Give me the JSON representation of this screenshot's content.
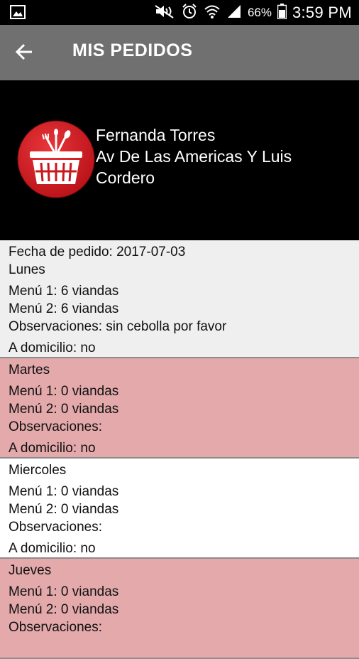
{
  "status_bar": {
    "battery_percent": "66%",
    "time": "3:59 PM"
  },
  "toolbar": {
    "title": "MIS PEDIDOS"
  },
  "profile": {
    "name": "Fernanda Torres",
    "address_line1": "Av De Las Americas Y Luis",
    "address_line2": "Cordero"
  },
  "order": {
    "date_text": "Fecha de pedido: 2017-07-03",
    "days": [
      {
        "day": "Lunes",
        "menu1": "Menú 1: 6 viandas",
        "menu2": "Menú 2: 6 viandas",
        "obs": "Observaciones: sin cebolla por favor",
        "delivery": "A domicilio: no"
      },
      {
        "day": "Martes",
        "menu1": "Menú 1: 0 viandas",
        "menu2": "Menú 2: 0 viandas",
        "obs": "Observaciones:",
        "delivery": "A domicilio: no"
      },
      {
        "day": "Miercoles",
        "menu1": "Menú 1: 0 viandas",
        "menu2": "Menú 2: 0 viandas",
        "obs": "Observaciones:",
        "delivery": "A domicilio: no"
      },
      {
        "day": "Jueves",
        "menu1": "Menú 1: 0 viandas",
        "menu2": "Menú 2: 0 viandas",
        "obs": "Observaciones:",
        "delivery": ""
      }
    ]
  },
  "colors": {
    "toolbar": "#707070",
    "row_light": "#efefef",
    "row_pink": "#e3a9ab",
    "logo_red": "#d11f25"
  }
}
